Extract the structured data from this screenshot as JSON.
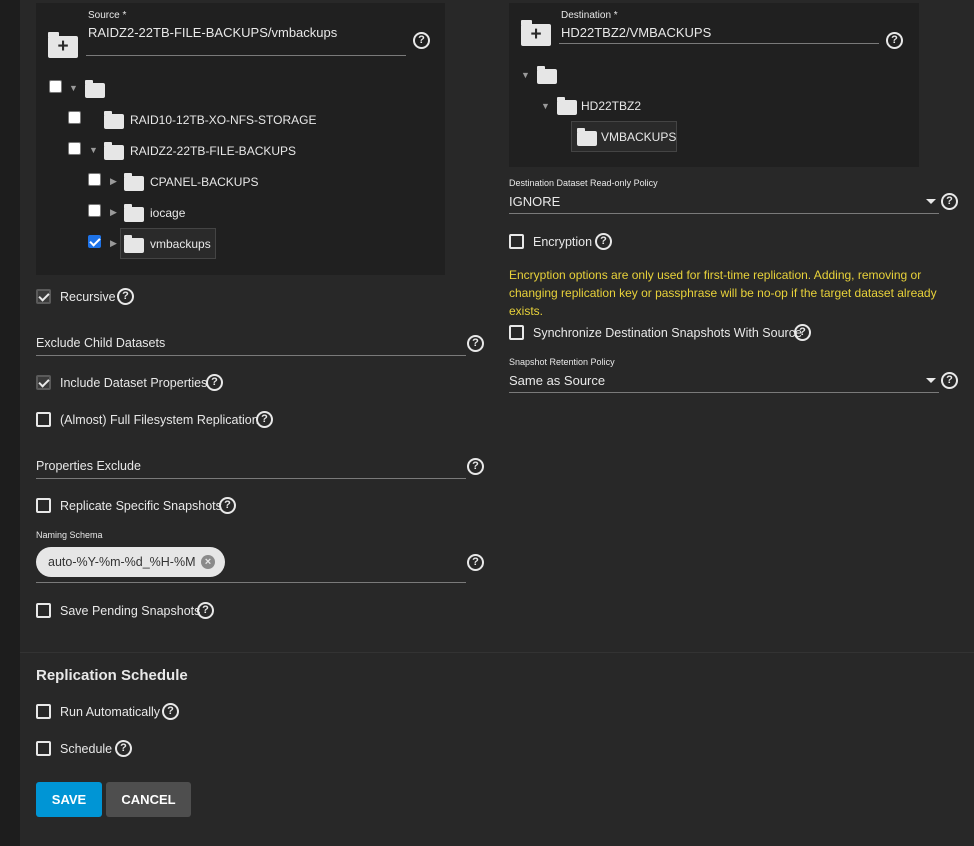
{
  "source": {
    "label": "Source *",
    "value": "RAIDZ2-22TB-FILE-BACKUPS/vmbackups",
    "tree": {
      "raid10": "RAID10-12TB-XO-NFS-STORAGE",
      "raidz2": "RAIDZ2-22TB-FILE-BACKUPS",
      "cpanel": "CPANEL-BACKUPS",
      "iocage": "iocage",
      "vmbackups": "vmbackups"
    }
  },
  "destination": {
    "label": "Destination *",
    "value": "HD22TBZ2/VMBACKUPS",
    "tree": {
      "pool": "HD22TBZ2",
      "child": "VMBACKUPS"
    }
  },
  "recursive": {
    "label": "Recursive",
    "checked": true
  },
  "exclude_child": {
    "label": "Exclude Child Datasets"
  },
  "include_props": {
    "label": "Include Dataset Properties",
    "checked": true
  },
  "full_fs": {
    "label": "(Almost) Full Filesystem Replication",
    "checked": false
  },
  "props_exclude": {
    "label": "Properties Exclude"
  },
  "replicate_specific": {
    "label": "Replicate Specific Snapshots",
    "checked": false
  },
  "naming_schema": {
    "label": "Naming Schema",
    "chip": "auto-%Y-%m-%d_%H-%M"
  },
  "save_pending": {
    "label": "Save Pending Snapshots",
    "checked": false
  },
  "readonly_policy": {
    "label": "Destination Dataset Read-only Policy",
    "value": "IGNORE"
  },
  "encryption": {
    "label": "Encryption",
    "checked": false,
    "warning": "Encryption options are only used for first-time replication. Adding, removing or changing replication key or passphrase will be no-op if the target dataset already exists."
  },
  "sync_dest": {
    "label": "Synchronize Destination Snapshots With Source",
    "checked": false
  },
  "retention": {
    "label": "Snapshot Retention Policy",
    "value": "Same as Source"
  },
  "schedule_section": {
    "title": "Replication Schedule",
    "run_auto": "Run Automatically",
    "schedule": "Schedule"
  },
  "buttons": {
    "save": "SAVE",
    "cancel": "CANCEL"
  },
  "help_glyph": "?",
  "add_glyph": "+",
  "close_glyph": "×",
  "colors": {
    "accent": "#0095d5",
    "warning": "#e8d23a",
    "checkbox_checked": "#1e73e8"
  }
}
